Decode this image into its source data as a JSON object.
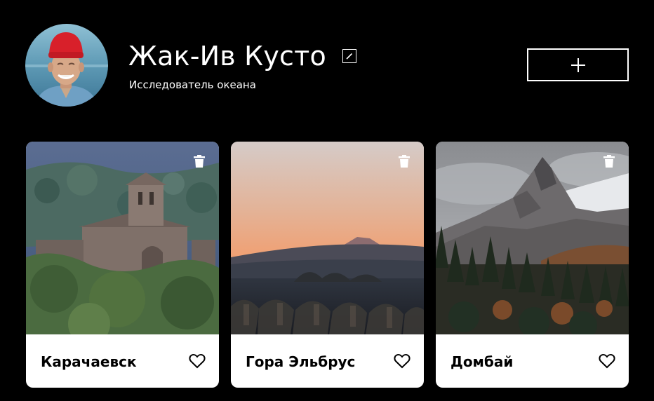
{
  "profile": {
    "name": "Жак-Ив Кусто",
    "about": "Исследователь океана",
    "edit_icon": "pencil-icon",
    "add_icon": "plus-icon"
  },
  "cards": [
    {
      "title": "Карачаевск",
      "delete_icon": "trash-icon",
      "like_icon": "heart-icon"
    },
    {
      "title": "Гора Эльбрус",
      "delete_icon": "trash-icon",
      "like_icon": "heart-icon"
    },
    {
      "title": "Домбай",
      "delete_icon": "trash-icon",
      "like_icon": "heart-icon"
    }
  ],
  "colors": {
    "background": "#000000",
    "text": "#ffffff",
    "card": "#ffffff",
    "card_text": "#000000"
  }
}
